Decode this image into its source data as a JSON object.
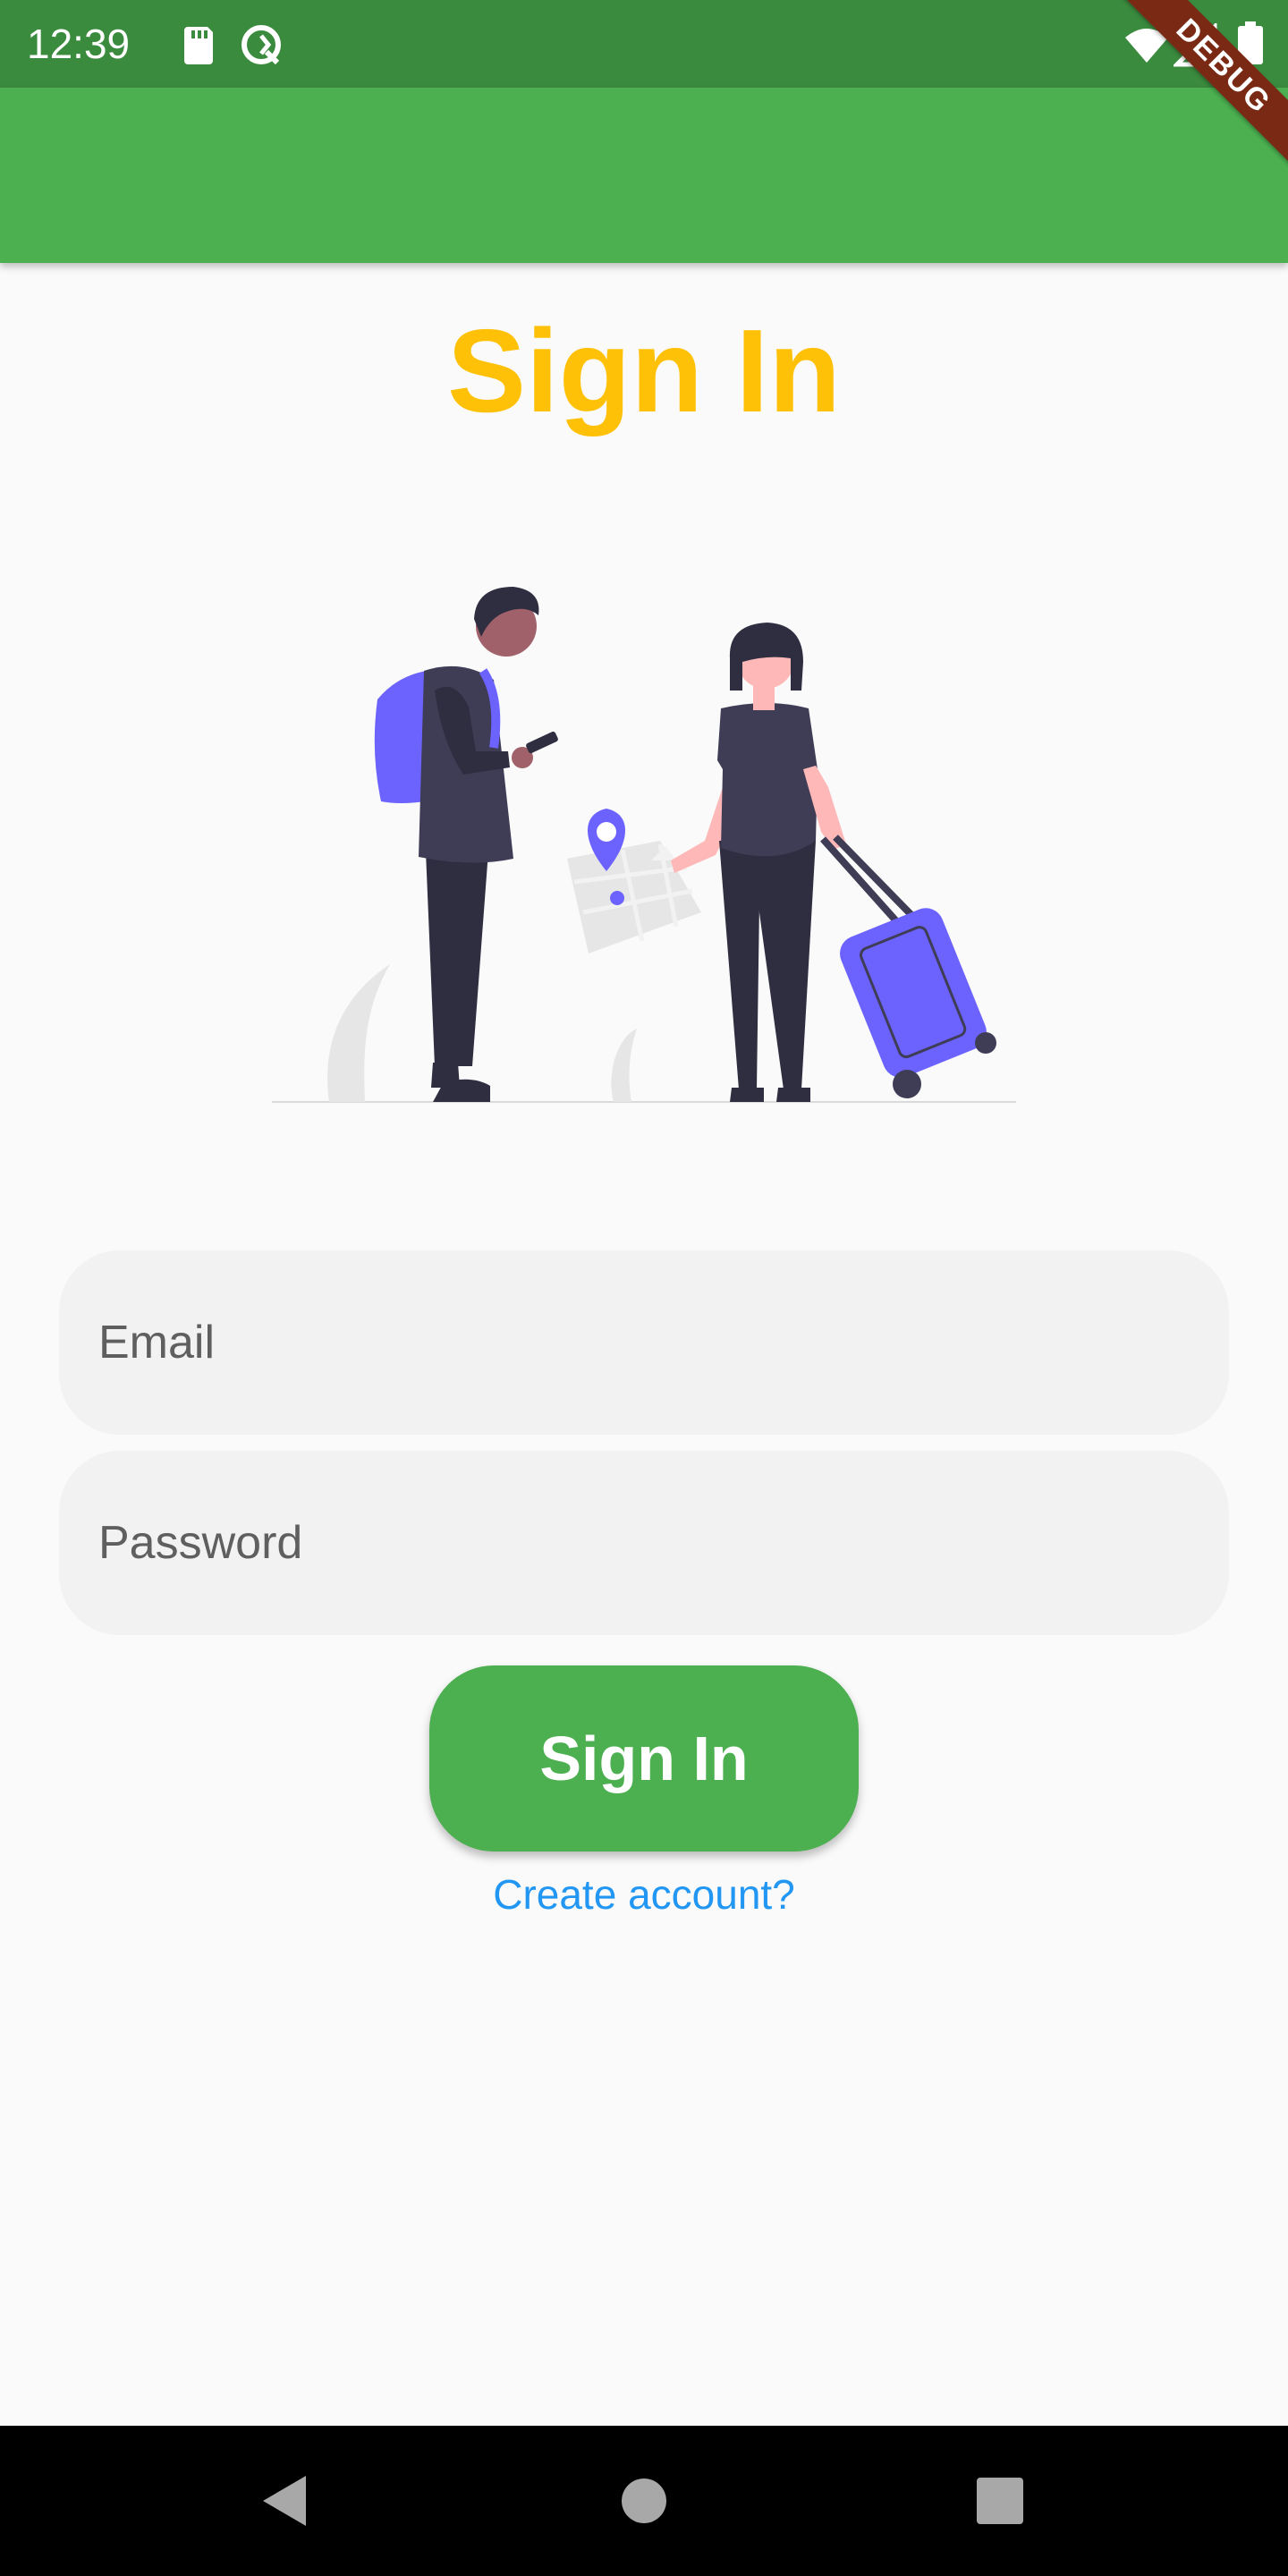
{
  "status_bar": {
    "time": "12:39",
    "icons": [
      "sd-card-icon",
      "sync-icon",
      "wifi-icon",
      "signal-icon",
      "battery-icon"
    ]
  },
  "debug_banner": {
    "label": "DEBUG"
  },
  "page": {
    "title": "Sign In"
  },
  "form": {
    "email_placeholder": "Email",
    "email_value": "",
    "password_placeholder": "Password",
    "password_value": "",
    "submit_label": "Sign In",
    "create_account_label": "Create account?"
  },
  "nav_bar": {
    "buttons": [
      "back-icon",
      "home-icon",
      "recents-icon"
    ]
  },
  "colors": {
    "status_bar": "#3B8B3F",
    "app_bar": "#4CAF50",
    "title": "#FFC107",
    "button": "#4CAF50",
    "link": "#2196F3",
    "input_bg": "#F2F2F2",
    "illustration_accent": "#6C63FF"
  }
}
